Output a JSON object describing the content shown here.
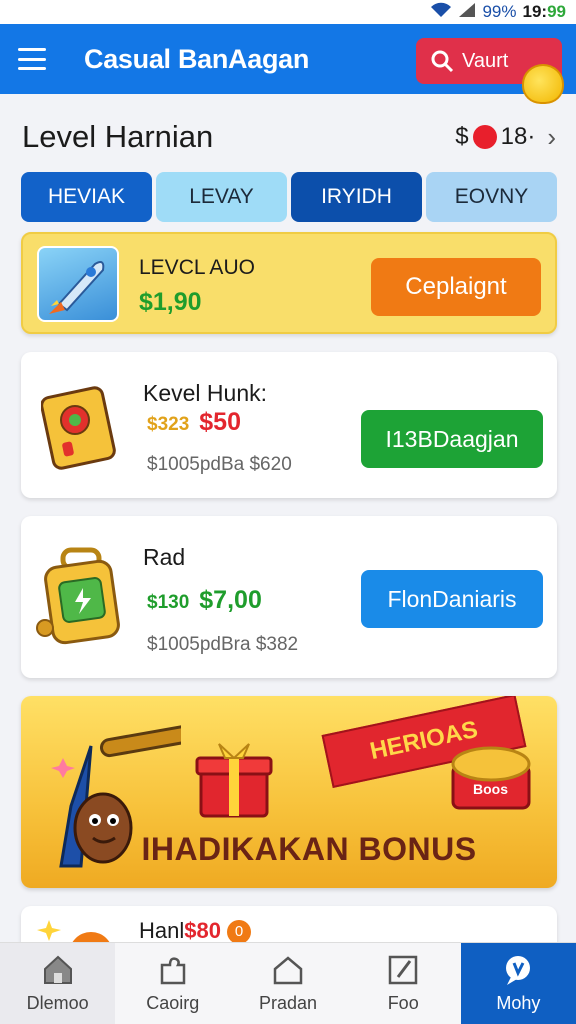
{
  "status": {
    "battery": "99%",
    "time_prefix": "19:",
    "time_hl": "99"
  },
  "app": {
    "title": "Casual BanAagan",
    "search_label": "Vaurt"
  },
  "header": {
    "title": "Level Harnian",
    "counter_prefix": "$",
    "counter_value": "18·"
  },
  "tabs": [
    {
      "label": "HEVIAK"
    },
    {
      "label": "LEVAY"
    },
    {
      "label": "IRYIDH"
    },
    {
      "label": "EOVNY"
    }
  ],
  "featured": {
    "name": "LEVCL AUO",
    "price": "$1,90",
    "cta": "Ceplaignt"
  },
  "items": [
    {
      "name": "Kevel Hunk:",
      "old_price": "$323",
      "new_price": "$50",
      "meta": "$1005pdBa $620",
      "cta": "I13BDaagjan"
    },
    {
      "name": "Rad",
      "old_price": "$130",
      "new_price": "$7,00",
      "meta": "$1005pdBra $382",
      "cta": "FlonDaniaris"
    }
  ],
  "banner": {
    "ribbon": "HERIOAS",
    "title": "IHADIKAKAN BONUS",
    "chest_label": "Boos"
  },
  "partial_item": {
    "name": "Hanl",
    "price": "$80",
    "badge": "0"
  },
  "nav": [
    {
      "label": "Dlemoo",
      "icon": "home-icon"
    },
    {
      "label": "Caoirg",
      "icon": "puzzle-icon"
    },
    {
      "label": "Pradan",
      "icon": "house-outline-icon"
    },
    {
      "label": "Foo",
      "icon": "edit-icon"
    },
    {
      "label": "Mohy",
      "icon": "chat-icon"
    }
  ],
  "colors": {
    "primary": "#1377e6",
    "accent_red": "#e0304a",
    "accent_orange": "#f07a14",
    "accent_green": "#1da336",
    "accent_blue": "#1a8be8",
    "banner_yellow": "#f7c13a"
  }
}
